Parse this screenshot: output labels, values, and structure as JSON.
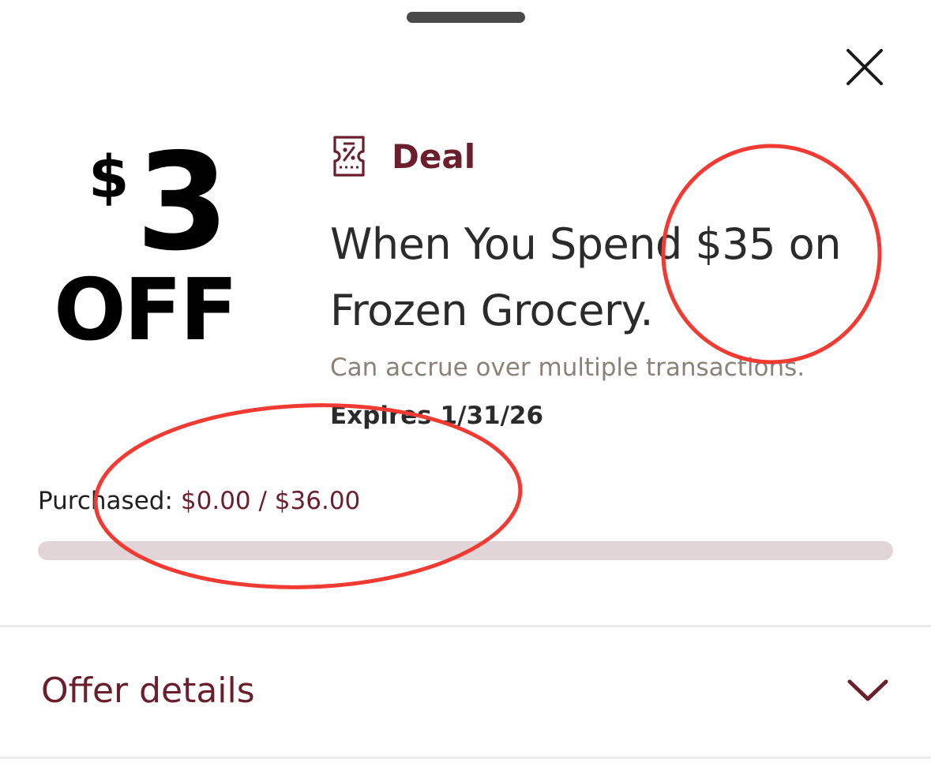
{
  "sheet": {
    "close_icon": "close-icon"
  },
  "offer": {
    "amount_currency": "$",
    "amount_number": "3",
    "amount_suffix": "OFF",
    "type_icon": "coupon-icon",
    "type_label": "Deal",
    "title": "When You Spend $35 on Frozen Grocery.",
    "note": "Can accrue over multiple transactions.",
    "expiry": "Expires 1/31/26"
  },
  "progress": {
    "label": "Purchased:",
    "value": "$0.00 / $36.00",
    "fraction": 0.0
  },
  "details": {
    "label": "Offer details",
    "chevron_icon": "chevron-down-icon"
  },
  "colors": {
    "accent": "#6b1e2b",
    "track": "#e2d5d7",
    "annotation": "#f03a32"
  }
}
